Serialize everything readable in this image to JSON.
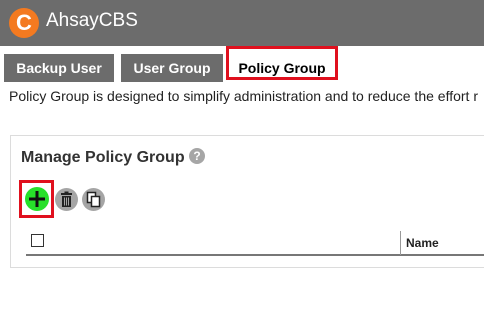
{
  "app": {
    "logo_letter": "C",
    "name": "AhsayCBS",
    "brand_color": "#f47a20"
  },
  "tabs": [
    {
      "label": "Backup User",
      "active": false
    },
    {
      "label": "User Group",
      "active": false
    },
    {
      "label": "Policy Group",
      "active": true
    }
  ],
  "description": "Policy Group is designed to simplify administration and to reduce the effort r",
  "panel": {
    "title": "Manage Policy Group",
    "help_icon_text": "?",
    "toolbar": {
      "add_icon": "plus-icon",
      "delete_icon": "trash-icon",
      "copy_icon": "copy-icon"
    },
    "table": {
      "columns": [
        "Name"
      ]
    }
  },
  "highlight_color": "#e0101e"
}
